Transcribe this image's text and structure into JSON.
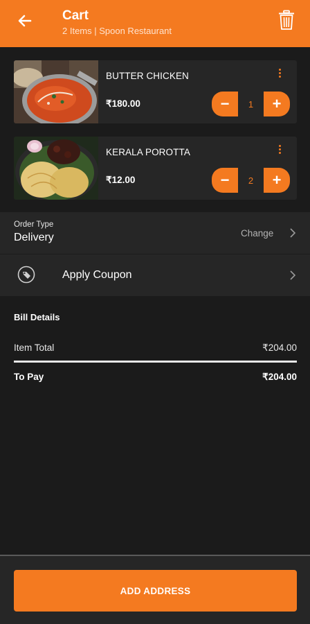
{
  "colors": {
    "accent": "#f47a20",
    "background": "#1b1b1b",
    "card": "#262626"
  },
  "header": {
    "title": "Cart",
    "subtitle": "2 Items | Spoon Restaurant",
    "back_icon": "arrow-left-icon",
    "trash_icon": "trash-icon"
  },
  "cart": {
    "items": [
      {
        "name": "BUTTER CHICKEN",
        "price": "₹180.00",
        "quantity": "1",
        "image": "butter-chicken-photo"
      },
      {
        "name": "KERALA POROTTA",
        "price": "₹12.00",
        "quantity": "2",
        "image": "kerala-porotta-photo"
      }
    ],
    "minus_symbol": "−",
    "plus_symbol": "+"
  },
  "order": {
    "type_label": "Order Type",
    "type_value": "Delivery",
    "change_label": "Change"
  },
  "coupon": {
    "label": "Apply Coupon",
    "icon": "coupon-tag-icon"
  },
  "bill": {
    "title": "Bill Details",
    "item_total_label": "Item Total",
    "item_total_value": "₹204.00",
    "to_pay_label": "To Pay",
    "to_pay_value": "₹204.00"
  },
  "footer": {
    "button_label": "ADD ADDRESS"
  }
}
